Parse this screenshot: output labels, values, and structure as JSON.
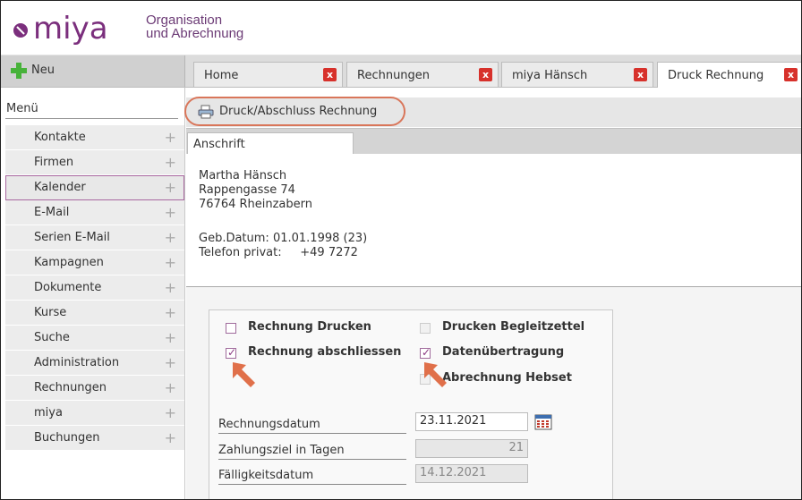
{
  "header": {
    "logo_text": "miya",
    "org_line1": "Organisation",
    "org_line2": "und Abrechnung",
    "brand_color": "#7b2f7d"
  },
  "topbar": {
    "new_label": "Neu",
    "tabs": [
      {
        "label": "Home",
        "active": false
      },
      {
        "label": "Rechnungen",
        "active": false
      },
      {
        "label": "miya Hänsch",
        "active": false
      },
      {
        "label": "Druck Rechnung",
        "active": true
      }
    ],
    "close_glyph": "x"
  },
  "sidebar": {
    "menu_title": "Menü",
    "items": [
      {
        "label": "Kontakte"
      },
      {
        "label": "Firmen"
      },
      {
        "label": "Kalender",
        "selected": true
      },
      {
        "label": "E-Mail"
      },
      {
        "label": "Serien E-Mail"
      },
      {
        "label": "Kampagnen"
      },
      {
        "label": "Dokumente"
      },
      {
        "label": "Kurse"
      },
      {
        "label": "Suche"
      },
      {
        "label": "Administration"
      },
      {
        "label": "Rechnungen"
      },
      {
        "label": "miya"
      },
      {
        "label": "Buchungen"
      }
    ],
    "expand_glyph": "+"
  },
  "toolbar": {
    "print_label": "Druck/Abschluss Rechnung",
    "highlight_color": "#d9765a"
  },
  "section": {
    "tab_label": "Anschrift"
  },
  "address": {
    "name": "Martha Hänsch",
    "street": "Rappengasse 74",
    "city": "76764 Rheinzabern",
    "birth": "Geb.Datum: 01.01.1998 (23)",
    "phone": "Telefon privat:     +49 7272"
  },
  "options": {
    "print_invoice": {
      "label": "Rechnung Drucken",
      "checked": false
    },
    "close_invoice": {
      "label": "Rechnung abschliessen",
      "checked": true
    },
    "print_slip": {
      "label": "Drucken Begleitzettel",
      "checked": false,
      "disabled": true
    },
    "data_transfer": {
      "label": "Datenübertragung",
      "checked": true
    },
    "billing_hebset": {
      "label": "Abrechnung Hebset",
      "checked": false,
      "disabled": true
    },
    "check_glyph": "✓"
  },
  "fields": {
    "invoice_date": {
      "label": "Rechnungsdatum",
      "value": "23.11.2021"
    },
    "payment_days": {
      "label": "Zahlungsziel in Tagen",
      "value": "21"
    },
    "due_date": {
      "label": "Fälligkeitsdatum",
      "value": "14.12.2021"
    }
  },
  "annotation_color": "#e0704a"
}
